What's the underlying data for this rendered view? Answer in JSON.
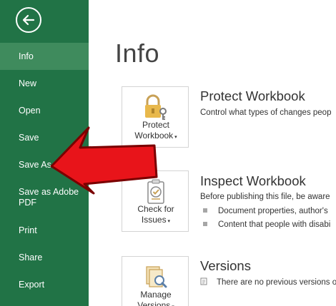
{
  "sidebar": {
    "back_icon": "back-arrow-icon",
    "background_color": "#217346",
    "items": [
      {
        "label": "Info",
        "active": true
      },
      {
        "label": "New"
      },
      {
        "label": "Open"
      },
      {
        "label": "Save"
      },
      {
        "label": "Save As"
      },
      {
        "label_line1": "Save as Adobe",
        "label_line2": "PDF"
      },
      {
        "label": "Print"
      },
      {
        "label": "Share"
      },
      {
        "label": "Export"
      }
    ]
  },
  "main": {
    "title": "Info",
    "sections": [
      {
        "tile_label_line1": "Protect",
        "tile_label_line2": "Workbook",
        "tile_icon": "lock-key-icon",
        "title": "Protect Workbook",
        "description": "Control what types of changes peop"
      },
      {
        "tile_label_line1": "Check for",
        "tile_label_line2": "Issues",
        "tile_icon": "checklist-icon",
        "title": "Inspect Workbook",
        "description": "Before publishing this file, be aware",
        "bullets": [
          "Document properties, author's",
          "Content that people with disabi"
        ]
      },
      {
        "tile_label_line1": "Manage",
        "tile_label_line2": "Versions",
        "tile_icon": "versions-search-icon",
        "title": "Versions",
        "description": "There are no previous versions o"
      }
    ]
  },
  "annotation": {
    "type": "red-arrow-pointing-left",
    "color": "#e8141a",
    "points_to": "Save As"
  }
}
